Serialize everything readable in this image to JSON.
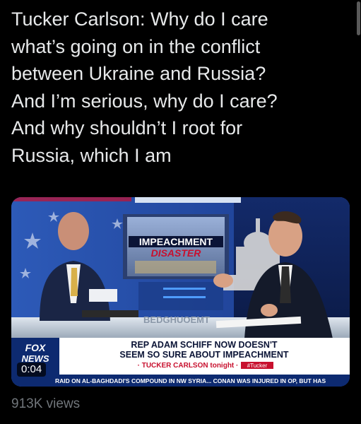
{
  "tweet": {
    "text": "Tucker Carlson: Why do I care\nwhat’s going on in the conflict\nbetween Ukraine and Russia?\nAnd I’m serious, why do I care?\nAnd why shouldn’t I root for\nRussia, which I am",
    "views": "913K views"
  },
  "video": {
    "timestamp": "0:04",
    "screen_title_1": "IMPEACHMENT",
    "screen_title_2": "DISASTER",
    "desk_text": "BEDGHUOEMT",
    "network_logo_1": "FOX",
    "network_logo_2": "NEWS",
    "headline_1": "REP ADAM SCHIFF NOW DOESN'T",
    "headline_2": "SEEM SO SURE ABOUT IMPEACHMENT",
    "show_name": "· TUCKER CARLSON tonight ·",
    "hashtag": "#Tucker",
    "ticker": "RAID ON AL-BAGHDADI'S COMPOUND IN NW SYRIA...   CONAN WAS INJURED IN OP, BUT HAS"
  },
  "colors": {
    "background": "#000000",
    "text": "#e7e9ea",
    "muted": "#71767b",
    "fox_blue": "#0d2a70",
    "fox_red": "#c8102e"
  }
}
